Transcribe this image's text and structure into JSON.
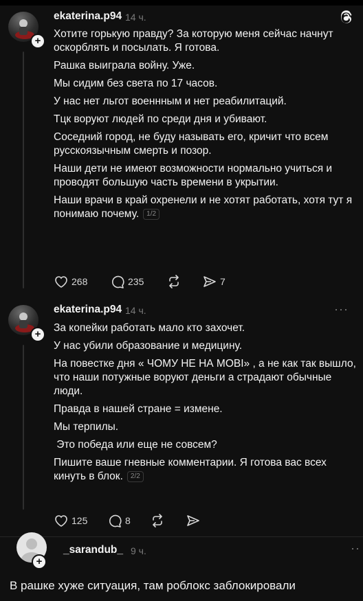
{
  "posts": [
    {
      "username": "ekaterina.p94",
      "time": "14 ч.",
      "paragraphs": [
        "Хотите горькую правду? За которую меня сейчас начнут оскорблять и посылать. Я готова.",
        "Рашка выиграла войну. Уже.",
        "Мы сидим без света по 17 часов.",
        "У нас нет льгот военнным и нет реабилитаций.",
        "Тцк воруют людей по среди дня и убивают.",
        "Соседний город, не буду называть его, кричит что всем русскоязычным смерть и позор.",
        "Наши дети не имеют возможности нормально учиться и проводят большую часть времени в укрытии.",
        "Наши врачи в край охренели и не хотят работать, хотя тут я понимаю почему."
      ],
      "page": "1/2",
      "likes": "268",
      "comments": "235",
      "reposts": "",
      "shares": "7"
    },
    {
      "username": "ekaterina.p94",
      "time": "14 ч.",
      "paragraphs": [
        "За копейки работать мало кто захочет.",
        "У нас убили образование и медицину.",
        "На повестке дня « ЧОМУ НЕ НА МОВІ» , а не как так вышло, что наши потужные воруют деньги а страдают обычные люди.",
        "Правда в нашей стране = измене.",
        "Мы терпилы.",
        " Это победа или еще не совсем?",
        "Пишите ваше гневные комментарии. Я готова вас всех кинуть в блок."
      ],
      "page": "2/2",
      "likes": "125",
      "comments": "8",
      "reposts": "",
      "shares": ""
    }
  ],
  "reply": {
    "username": "_sarandub_",
    "time": "9 ч.",
    "text": "В рашке хуже ситуация, там роблокс заблокировали"
  },
  "icons": {
    "more": "···",
    "app_logo": "threads-logo"
  }
}
